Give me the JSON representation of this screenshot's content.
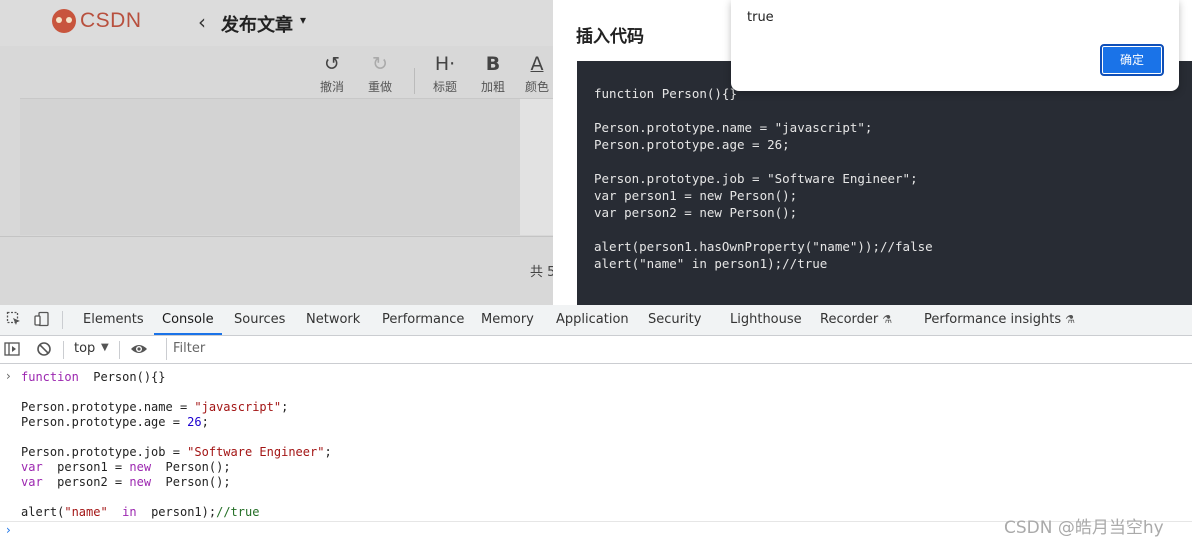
{
  "editor": {
    "logo_text": "CSDN",
    "back_glyph": "‹",
    "title": "发布文章",
    "title_caret": "▾",
    "toolbar": [
      {
        "id": "undo",
        "icon": "↺",
        "label": "撤消",
        "dim": false
      },
      {
        "id": "redo",
        "icon": "↻",
        "label": "重做",
        "dim": true
      },
      {
        "id": "heading",
        "icon": "H·",
        "label": "标题",
        "dim": false
      },
      {
        "id": "bold",
        "icon": "B",
        "label": "加粗",
        "dim": false
      },
      {
        "id": "color",
        "icon": "A",
        "label": "颜色",
        "dim": false
      }
    ],
    "word_count_prefix": "共 5"
  },
  "code_dialog": {
    "title": "插入代码",
    "code": "function Person(){}\n\nPerson.prototype.name = \"javascript\";\nPerson.prototype.age = 26;\n\nPerson.prototype.job = \"Software Engineer\";\nvar person1 = new Person();\nvar person2 = new Person();\n\nalert(person1.hasOwnProperty(\"name\"));//false\nalert(\"name\" in person1);//true"
  },
  "alert": {
    "message": "true",
    "ok_label": "确定"
  },
  "devtools": {
    "tabs": [
      {
        "label": "Elements",
        "active": false
      },
      {
        "label": "Console",
        "active": true
      },
      {
        "label": "Sources",
        "active": false
      },
      {
        "label": "Network",
        "active": false
      },
      {
        "label": "Performance",
        "active": false
      },
      {
        "label": "Memory",
        "active": false
      },
      {
        "label": "Application",
        "active": false
      },
      {
        "label": "Security",
        "active": false
      },
      {
        "label": "Lighthouse",
        "active": false
      },
      {
        "label": "Recorder",
        "active": false,
        "flask": true
      },
      {
        "label": "Performance insights",
        "active": false,
        "flask": true
      }
    ],
    "flask_glyph": "⚗",
    "context": "top",
    "context_caret": "▼",
    "filter_placeholder": "Filter",
    "prompt_glyph": "›",
    "console_lines": [
      [
        [
          "kw",
          "function"
        ],
        [
          "",
          "  Person(){}"
        ]
      ],
      [],
      [
        [
          "",
          "Person.prototype.name = "
        ],
        [
          "str",
          "\"javascript\""
        ],
        [
          "",
          ";"
        ]
      ],
      [
        [
          "",
          "Person.prototype.age = "
        ],
        [
          "num",
          "26"
        ],
        [
          "",
          ";"
        ]
      ],
      [],
      [
        [
          "",
          "Person.prototype.job = "
        ],
        [
          "str",
          "\"Software Engineer\""
        ],
        [
          "",
          ";"
        ]
      ],
      [
        [
          "kw",
          "var"
        ],
        [
          "",
          "  person1 = "
        ],
        [
          "kw",
          "new"
        ],
        [
          "",
          "  Person();"
        ]
      ],
      [
        [
          "kw",
          "var"
        ],
        [
          "",
          "  person2 = "
        ],
        [
          "kw",
          "new"
        ],
        [
          "",
          "  Person();"
        ]
      ],
      [],
      [
        [
          "",
          "alert("
        ],
        [
          "str",
          "\"name\""
        ],
        [
          "",
          "  "
        ],
        [
          "kw",
          "in"
        ],
        [
          "",
          "  person1);"
        ],
        [
          "cm",
          "//true"
        ]
      ]
    ]
  },
  "watermark": "CSDN @皓月当空hy"
}
